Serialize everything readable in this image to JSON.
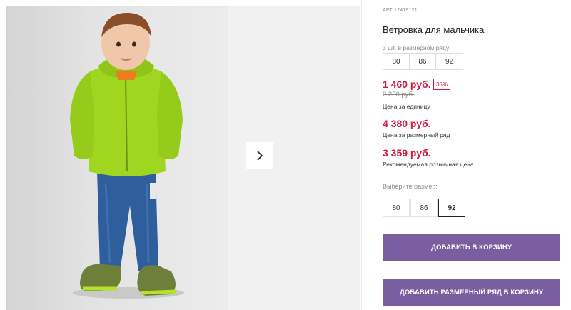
{
  "product": {
    "article": "АРТ 12419121",
    "title": "Ветровка для мальчика",
    "row_caption": "3 шт. в размерном ряду",
    "row_sizes": [
      "80",
      "86",
      "92"
    ],
    "price": "1 460 руб.",
    "discount": "35%",
    "old_price": "2 250 руб.",
    "price_caption": "Цена за единицу",
    "row_price": "4 380 руб.",
    "row_price_caption": "Цена за размерный ряд",
    "retail_price": "3 359 руб.",
    "retail_caption": "Рекомендуемая розничная цена"
  },
  "size_picker": {
    "label": "Выберите размер:",
    "options": [
      "80",
      "86",
      "92"
    ],
    "selected": "92"
  },
  "buttons": {
    "add_to_cart": "ДОБАВИТЬ В КОРЗИНУ",
    "add_row_to_cart": "ДОБАВИТЬ РАЗМЕРНЫЙ РЯД В КОРЗИНУ"
  },
  "colors": {
    "accent": "#7a5e9f",
    "price_red": "#d6163c",
    "jacket": "#9fd620"
  },
  "icons": {
    "gallery_next": "chevron-right-icon"
  }
}
